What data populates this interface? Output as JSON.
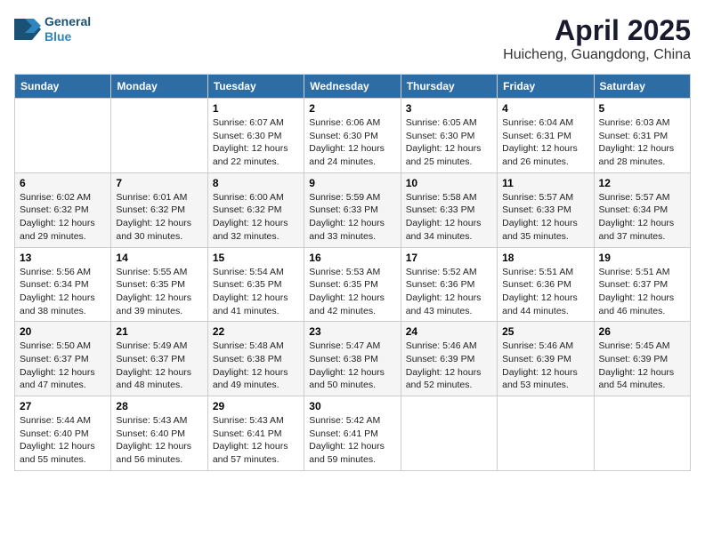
{
  "header": {
    "logo_line1": "General",
    "logo_line2": "Blue",
    "title": "April 2025",
    "subtitle": "Huicheng, Guangdong, China"
  },
  "days_of_week": [
    "Sunday",
    "Monday",
    "Tuesday",
    "Wednesday",
    "Thursday",
    "Friday",
    "Saturday"
  ],
  "weeks": [
    [
      {
        "num": "",
        "info": ""
      },
      {
        "num": "",
        "info": ""
      },
      {
        "num": "1",
        "info": "Sunrise: 6:07 AM\nSunset: 6:30 PM\nDaylight: 12 hours and 22 minutes."
      },
      {
        "num": "2",
        "info": "Sunrise: 6:06 AM\nSunset: 6:30 PM\nDaylight: 12 hours and 24 minutes."
      },
      {
        "num": "3",
        "info": "Sunrise: 6:05 AM\nSunset: 6:30 PM\nDaylight: 12 hours and 25 minutes."
      },
      {
        "num": "4",
        "info": "Sunrise: 6:04 AM\nSunset: 6:31 PM\nDaylight: 12 hours and 26 minutes."
      },
      {
        "num": "5",
        "info": "Sunrise: 6:03 AM\nSunset: 6:31 PM\nDaylight: 12 hours and 28 minutes."
      }
    ],
    [
      {
        "num": "6",
        "info": "Sunrise: 6:02 AM\nSunset: 6:32 PM\nDaylight: 12 hours and 29 minutes."
      },
      {
        "num": "7",
        "info": "Sunrise: 6:01 AM\nSunset: 6:32 PM\nDaylight: 12 hours and 30 minutes."
      },
      {
        "num": "8",
        "info": "Sunrise: 6:00 AM\nSunset: 6:32 PM\nDaylight: 12 hours and 32 minutes."
      },
      {
        "num": "9",
        "info": "Sunrise: 5:59 AM\nSunset: 6:33 PM\nDaylight: 12 hours and 33 minutes."
      },
      {
        "num": "10",
        "info": "Sunrise: 5:58 AM\nSunset: 6:33 PM\nDaylight: 12 hours and 34 minutes."
      },
      {
        "num": "11",
        "info": "Sunrise: 5:57 AM\nSunset: 6:33 PM\nDaylight: 12 hours and 35 minutes."
      },
      {
        "num": "12",
        "info": "Sunrise: 5:57 AM\nSunset: 6:34 PM\nDaylight: 12 hours and 37 minutes."
      }
    ],
    [
      {
        "num": "13",
        "info": "Sunrise: 5:56 AM\nSunset: 6:34 PM\nDaylight: 12 hours and 38 minutes."
      },
      {
        "num": "14",
        "info": "Sunrise: 5:55 AM\nSunset: 6:35 PM\nDaylight: 12 hours and 39 minutes."
      },
      {
        "num": "15",
        "info": "Sunrise: 5:54 AM\nSunset: 6:35 PM\nDaylight: 12 hours and 41 minutes."
      },
      {
        "num": "16",
        "info": "Sunrise: 5:53 AM\nSunset: 6:35 PM\nDaylight: 12 hours and 42 minutes."
      },
      {
        "num": "17",
        "info": "Sunrise: 5:52 AM\nSunset: 6:36 PM\nDaylight: 12 hours and 43 minutes."
      },
      {
        "num": "18",
        "info": "Sunrise: 5:51 AM\nSunset: 6:36 PM\nDaylight: 12 hours and 44 minutes."
      },
      {
        "num": "19",
        "info": "Sunrise: 5:51 AM\nSunset: 6:37 PM\nDaylight: 12 hours and 46 minutes."
      }
    ],
    [
      {
        "num": "20",
        "info": "Sunrise: 5:50 AM\nSunset: 6:37 PM\nDaylight: 12 hours and 47 minutes."
      },
      {
        "num": "21",
        "info": "Sunrise: 5:49 AM\nSunset: 6:37 PM\nDaylight: 12 hours and 48 minutes."
      },
      {
        "num": "22",
        "info": "Sunrise: 5:48 AM\nSunset: 6:38 PM\nDaylight: 12 hours and 49 minutes."
      },
      {
        "num": "23",
        "info": "Sunrise: 5:47 AM\nSunset: 6:38 PM\nDaylight: 12 hours and 50 minutes."
      },
      {
        "num": "24",
        "info": "Sunrise: 5:46 AM\nSunset: 6:39 PM\nDaylight: 12 hours and 52 minutes."
      },
      {
        "num": "25",
        "info": "Sunrise: 5:46 AM\nSunset: 6:39 PM\nDaylight: 12 hours and 53 minutes."
      },
      {
        "num": "26",
        "info": "Sunrise: 5:45 AM\nSunset: 6:39 PM\nDaylight: 12 hours and 54 minutes."
      }
    ],
    [
      {
        "num": "27",
        "info": "Sunrise: 5:44 AM\nSunset: 6:40 PM\nDaylight: 12 hours and 55 minutes."
      },
      {
        "num": "28",
        "info": "Sunrise: 5:43 AM\nSunset: 6:40 PM\nDaylight: 12 hours and 56 minutes."
      },
      {
        "num": "29",
        "info": "Sunrise: 5:43 AM\nSunset: 6:41 PM\nDaylight: 12 hours and 57 minutes."
      },
      {
        "num": "30",
        "info": "Sunrise: 5:42 AM\nSunset: 6:41 PM\nDaylight: 12 hours and 59 minutes."
      },
      {
        "num": "",
        "info": ""
      },
      {
        "num": "",
        "info": ""
      },
      {
        "num": "",
        "info": ""
      }
    ]
  ]
}
